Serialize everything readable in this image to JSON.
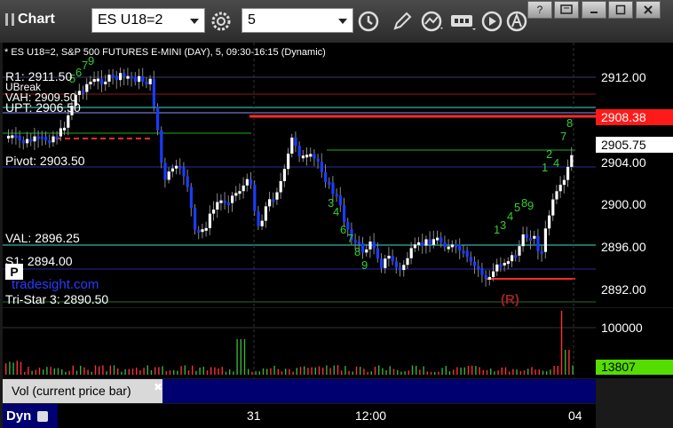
{
  "app": {
    "title": "Chart"
  },
  "toolbar": {
    "symbol": "ES U18=2",
    "interval": "5"
  },
  "chart": {
    "subtitle": "* ES U18=2, S&P 500 FUTURES E-MINI (DAY), 5, 09:30-16:15 (Dynamic)",
    "levels": {
      "r1": "R1: 2911.50",
      "ubreak": "UBreak",
      "vah": "VAH: 2909.50",
      "upt": "UPT: 2906.50",
      "pivot": "Pivot: 2903.50",
      "val": "VAL: 2896.25",
      "s1": "S1: 2894.00",
      "tristar": "Tri-Star 3: 2890.50"
    },
    "watermark": "tradesight.com",
    "p_badge": "P",
    "r_marker": "(R)",
    "price_ticks": [
      "2912.00",
      "2904.00",
      "2900.00",
      "2896.00",
      "2892.00"
    ],
    "last_price": "2905.75",
    "red_price": "2908.38",
    "volume_ticks": [
      "100000"
    ],
    "volume_current": "13807",
    "volume_label": "Vol (current price bar)",
    "date_ticks": [
      "31",
      "12:00",
      "04"
    ],
    "footer_label": "Dyn"
  },
  "colors": {
    "up": "#ffffff",
    "down": "#1a3cff",
    "vol": "#ff3030",
    "accent_red": "#ff2a2a",
    "accent_green": "#66ff00"
  }
}
